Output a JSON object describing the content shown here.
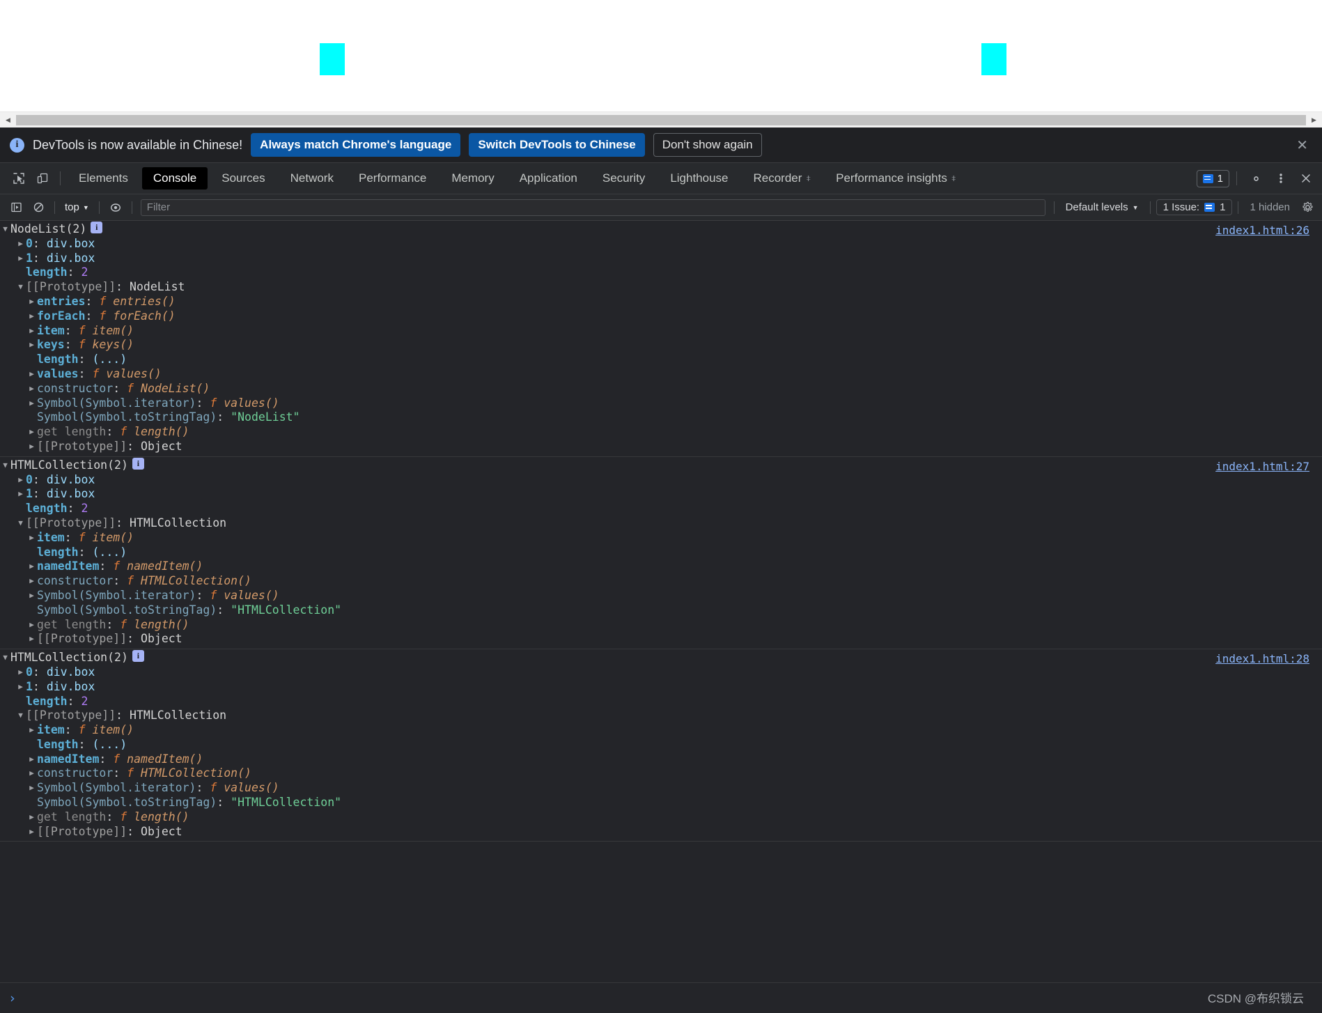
{
  "page": {
    "boxes": [
      {
        "name": "box-0"
      },
      {
        "name": "box-1"
      }
    ],
    "box_color": "#00ffff",
    "background": "#ffffff"
  },
  "banner": {
    "icon": "info-icon",
    "text": "DevTools is now available in Chinese!",
    "primary_button": "Always match Chrome's language",
    "secondary_button": "Switch DevTools to Chinese",
    "dismiss_button": "Don't show again",
    "close_label": "✕"
  },
  "tabbar": {
    "inspect_icon": "inspect-element-icon",
    "device_icon": "device-toolbar-icon",
    "tabs": [
      {
        "label": "Elements",
        "active": false,
        "flask": false
      },
      {
        "label": "Console",
        "active": true,
        "flask": false
      },
      {
        "label": "Sources",
        "active": false,
        "flask": false
      },
      {
        "label": "Network",
        "active": false,
        "flask": false
      },
      {
        "label": "Performance",
        "active": false,
        "flask": false
      },
      {
        "label": "Memory",
        "active": false,
        "flask": false
      },
      {
        "label": "Application",
        "active": false,
        "flask": false
      },
      {
        "label": "Security",
        "active": false,
        "flask": false
      },
      {
        "label": "Lighthouse",
        "active": false,
        "flask": false
      },
      {
        "label": "Recorder",
        "active": false,
        "flask": true
      },
      {
        "label": "Performance insights",
        "active": false,
        "flask": true
      }
    ],
    "issues_count": "1",
    "settings_icon": "gear-icon",
    "more_icon": "more-vertical-icon",
    "close_icon": "close-icon",
    "flask_glyph": "⧧"
  },
  "console_toolbar": {
    "execute_icon": "execute-snippet-icon",
    "clear_icon": "clear-console-icon",
    "context": "top",
    "eye_icon": "live-expression-icon",
    "filter_placeholder": "Filter",
    "filter_value": "",
    "levels": "Default levels",
    "issue_label": "1 Issue:",
    "issue_badge_count": "1",
    "hidden_label": "1 hidden",
    "settings_icon": "console-settings-gear-icon"
  },
  "console_logs": [
    {
      "source": "index1.html:26",
      "header": {
        "type": "NodeList",
        "count": "2",
        "text": "NodeList(2)"
      },
      "rows": [
        {
          "indent": 1,
          "tri": "closed",
          "parts": [
            {
              "t": "0",
              "c": "c-key"
            },
            {
              "t": ": ",
              "c": "c-punc"
            },
            {
              "t": "div.box",
              "c": "c-val"
            }
          ]
        },
        {
          "indent": 1,
          "tri": "closed",
          "parts": [
            {
              "t": "1",
              "c": "c-key"
            },
            {
              "t": ": ",
              "c": "c-punc"
            },
            {
              "t": "div.box",
              "c": "c-val"
            }
          ]
        },
        {
          "indent": 1,
          "tri": "none",
          "parts": [
            {
              "t": "length",
              "c": "c-key"
            },
            {
              "t": ": ",
              "c": "c-punc"
            },
            {
              "t": "2",
              "c": "c-num"
            }
          ]
        },
        {
          "indent": 1,
          "tri": "open",
          "parts": [
            {
              "t": "[[Prototype]]",
              "c": "c-proto"
            },
            {
              "t": ": ",
              "c": "c-punc"
            },
            {
              "t": "NodeList",
              "c": "c-plain"
            }
          ]
        },
        {
          "indent": 2,
          "tri": "closed",
          "parts": [
            {
              "t": "entries",
              "c": "c-key"
            },
            {
              "t": ": ",
              "c": "c-punc"
            },
            {
              "t": "f ",
              "c": "c-fnkw"
            },
            {
              "t": "entries()",
              "c": "c-fn"
            }
          ]
        },
        {
          "indent": 2,
          "tri": "closed",
          "parts": [
            {
              "t": "forEach",
              "c": "c-key"
            },
            {
              "t": ": ",
              "c": "c-punc"
            },
            {
              "t": "f ",
              "c": "c-fnkw"
            },
            {
              "t": "forEach()",
              "c": "c-fn"
            }
          ]
        },
        {
          "indent": 2,
          "tri": "closed",
          "parts": [
            {
              "t": "item",
              "c": "c-key"
            },
            {
              "t": ": ",
              "c": "c-punc"
            },
            {
              "t": "f ",
              "c": "c-fnkw"
            },
            {
              "t": "item()",
              "c": "c-fn"
            }
          ]
        },
        {
          "indent": 2,
          "tri": "closed",
          "parts": [
            {
              "t": "keys",
              "c": "c-key"
            },
            {
              "t": ": ",
              "c": "c-punc"
            },
            {
              "t": "f ",
              "c": "c-fnkw"
            },
            {
              "t": "keys()",
              "c": "c-fn"
            }
          ]
        },
        {
          "indent": 2,
          "tri": "none",
          "parts": [
            {
              "t": "length",
              "c": "c-key"
            },
            {
              "t": ": ",
              "c": "c-punc"
            },
            {
              "t": "(...)",
              "c": "c-dots"
            }
          ]
        },
        {
          "indent": 2,
          "tri": "closed",
          "parts": [
            {
              "t": "values",
              "c": "c-key"
            },
            {
              "t": ": ",
              "c": "c-punc"
            },
            {
              "t": "f ",
              "c": "c-fnkw"
            },
            {
              "t": "values()",
              "c": "c-fn"
            }
          ]
        },
        {
          "indent": 2,
          "tri": "closed",
          "parts": [
            {
              "t": "constructor",
              "c": "c-keyd"
            },
            {
              "t": ": ",
              "c": "c-punc"
            },
            {
              "t": "f ",
              "c": "c-fnkw"
            },
            {
              "t": "NodeList()",
              "c": "c-fn"
            }
          ]
        },
        {
          "indent": 2,
          "tri": "closed",
          "parts": [
            {
              "t": "Symbol(Symbol.iterator)",
              "c": "c-keyd"
            },
            {
              "t": ": ",
              "c": "c-punc"
            },
            {
              "t": "f ",
              "c": "c-fnkw"
            },
            {
              "t": "values()",
              "c": "c-fn"
            }
          ]
        },
        {
          "indent": 2,
          "tri": "none",
          "parts": [
            {
              "t": "Symbol(Symbol.toStringTag)",
              "c": "c-keyd"
            },
            {
              "t": ": ",
              "c": "c-punc"
            },
            {
              "t": "\"NodeList\"",
              "c": "c-str"
            }
          ]
        },
        {
          "indent": 2,
          "tri": "closed",
          "parts": [
            {
              "t": "get length",
              "c": "c-keyg"
            },
            {
              "t": ": ",
              "c": "c-punc"
            },
            {
              "t": "f ",
              "c": "c-fnkw"
            },
            {
              "t": "length()",
              "c": "c-fn"
            }
          ]
        },
        {
          "indent": 2,
          "tri": "closed",
          "parts": [
            {
              "t": "[[Prototype]]",
              "c": "c-proto"
            },
            {
              "t": ": ",
              "c": "c-punc"
            },
            {
              "t": "Object",
              "c": "c-plain"
            }
          ]
        }
      ]
    },
    {
      "source": "index1.html:27",
      "header": {
        "type": "HTMLCollection",
        "count": "2",
        "text": "HTMLCollection(2)"
      },
      "rows": [
        {
          "indent": 1,
          "tri": "closed",
          "parts": [
            {
              "t": "0",
              "c": "c-key"
            },
            {
              "t": ": ",
              "c": "c-punc"
            },
            {
              "t": "div.box",
              "c": "c-val"
            }
          ]
        },
        {
          "indent": 1,
          "tri": "closed",
          "parts": [
            {
              "t": "1",
              "c": "c-key"
            },
            {
              "t": ": ",
              "c": "c-punc"
            },
            {
              "t": "div.box",
              "c": "c-val"
            }
          ]
        },
        {
          "indent": 1,
          "tri": "none",
          "parts": [
            {
              "t": "length",
              "c": "c-key"
            },
            {
              "t": ": ",
              "c": "c-punc"
            },
            {
              "t": "2",
              "c": "c-num"
            }
          ]
        },
        {
          "indent": 1,
          "tri": "open",
          "parts": [
            {
              "t": "[[Prototype]]",
              "c": "c-proto"
            },
            {
              "t": ": ",
              "c": "c-punc"
            },
            {
              "t": "HTMLCollection",
              "c": "c-plain"
            }
          ]
        },
        {
          "indent": 2,
          "tri": "closed",
          "parts": [
            {
              "t": "item",
              "c": "c-key"
            },
            {
              "t": ": ",
              "c": "c-punc"
            },
            {
              "t": "f ",
              "c": "c-fnkw"
            },
            {
              "t": "item()",
              "c": "c-fn"
            }
          ]
        },
        {
          "indent": 2,
          "tri": "none",
          "parts": [
            {
              "t": "length",
              "c": "c-key"
            },
            {
              "t": ": ",
              "c": "c-punc"
            },
            {
              "t": "(...)",
              "c": "c-dots"
            }
          ]
        },
        {
          "indent": 2,
          "tri": "closed",
          "parts": [
            {
              "t": "namedItem",
              "c": "c-key"
            },
            {
              "t": ": ",
              "c": "c-punc"
            },
            {
              "t": "f ",
              "c": "c-fnkw"
            },
            {
              "t": "namedItem()",
              "c": "c-fn"
            }
          ]
        },
        {
          "indent": 2,
          "tri": "closed",
          "parts": [
            {
              "t": "constructor",
              "c": "c-keyd"
            },
            {
              "t": ": ",
              "c": "c-punc"
            },
            {
              "t": "f ",
              "c": "c-fnkw"
            },
            {
              "t": "HTMLCollection()",
              "c": "c-fn"
            }
          ]
        },
        {
          "indent": 2,
          "tri": "closed",
          "parts": [
            {
              "t": "Symbol(Symbol.iterator)",
              "c": "c-keyd"
            },
            {
              "t": ": ",
              "c": "c-punc"
            },
            {
              "t": "f ",
              "c": "c-fnkw"
            },
            {
              "t": "values()",
              "c": "c-fn"
            }
          ]
        },
        {
          "indent": 2,
          "tri": "none",
          "parts": [
            {
              "t": "Symbol(Symbol.toStringTag)",
              "c": "c-keyd"
            },
            {
              "t": ": ",
              "c": "c-punc"
            },
            {
              "t": "\"HTMLCollection\"",
              "c": "c-str"
            }
          ]
        },
        {
          "indent": 2,
          "tri": "closed",
          "parts": [
            {
              "t": "get length",
              "c": "c-keyg"
            },
            {
              "t": ": ",
              "c": "c-punc"
            },
            {
              "t": "f ",
              "c": "c-fnkw"
            },
            {
              "t": "length()",
              "c": "c-fn"
            }
          ]
        },
        {
          "indent": 2,
          "tri": "closed",
          "parts": [
            {
              "t": "[[Prototype]]",
              "c": "c-proto"
            },
            {
              "t": ": ",
              "c": "c-punc"
            },
            {
              "t": "Object",
              "c": "c-plain"
            }
          ]
        }
      ]
    },
    {
      "source": "index1.html:28",
      "header": {
        "type": "HTMLCollection",
        "count": "2",
        "text": "HTMLCollection(2)"
      },
      "rows": [
        {
          "indent": 1,
          "tri": "closed",
          "parts": [
            {
              "t": "0",
              "c": "c-key"
            },
            {
              "t": ": ",
              "c": "c-punc"
            },
            {
              "t": "div.box",
              "c": "c-val"
            }
          ]
        },
        {
          "indent": 1,
          "tri": "closed",
          "parts": [
            {
              "t": "1",
              "c": "c-key"
            },
            {
              "t": ": ",
              "c": "c-punc"
            },
            {
              "t": "div.box",
              "c": "c-val"
            }
          ]
        },
        {
          "indent": 1,
          "tri": "none",
          "parts": [
            {
              "t": "length",
              "c": "c-key"
            },
            {
              "t": ": ",
              "c": "c-punc"
            },
            {
              "t": "2",
              "c": "c-num"
            }
          ]
        },
        {
          "indent": 1,
          "tri": "open",
          "parts": [
            {
              "t": "[[Prototype]]",
              "c": "c-proto"
            },
            {
              "t": ": ",
              "c": "c-punc"
            },
            {
              "t": "HTMLCollection",
              "c": "c-plain"
            }
          ]
        },
        {
          "indent": 2,
          "tri": "closed",
          "parts": [
            {
              "t": "item",
              "c": "c-key"
            },
            {
              "t": ": ",
              "c": "c-punc"
            },
            {
              "t": "f ",
              "c": "c-fnkw"
            },
            {
              "t": "item()",
              "c": "c-fn"
            }
          ]
        },
        {
          "indent": 2,
          "tri": "none",
          "parts": [
            {
              "t": "length",
              "c": "c-key"
            },
            {
              "t": ": ",
              "c": "c-punc"
            },
            {
              "t": "(...)",
              "c": "c-dots"
            }
          ]
        },
        {
          "indent": 2,
          "tri": "closed",
          "parts": [
            {
              "t": "namedItem",
              "c": "c-key"
            },
            {
              "t": ": ",
              "c": "c-punc"
            },
            {
              "t": "f ",
              "c": "c-fnkw"
            },
            {
              "t": "namedItem()",
              "c": "c-fn"
            }
          ]
        },
        {
          "indent": 2,
          "tri": "closed",
          "parts": [
            {
              "t": "constructor",
              "c": "c-keyd"
            },
            {
              "t": ": ",
              "c": "c-punc"
            },
            {
              "t": "f ",
              "c": "c-fnkw"
            },
            {
              "t": "HTMLCollection()",
              "c": "c-fn"
            }
          ]
        },
        {
          "indent": 2,
          "tri": "closed",
          "parts": [
            {
              "t": "Symbol(Symbol.iterator)",
              "c": "c-keyd"
            },
            {
              "t": ": ",
              "c": "c-punc"
            },
            {
              "t": "f ",
              "c": "c-fnkw"
            },
            {
              "t": "values()",
              "c": "c-fn"
            }
          ]
        },
        {
          "indent": 2,
          "tri": "none",
          "parts": [
            {
              "t": "Symbol(Symbol.toStringTag)",
              "c": "c-keyd"
            },
            {
              "t": ": ",
              "c": "c-punc"
            },
            {
              "t": "\"HTMLCollection\"",
              "c": "c-str"
            }
          ]
        },
        {
          "indent": 2,
          "tri": "closed",
          "parts": [
            {
              "t": "get length",
              "c": "c-keyg"
            },
            {
              "t": ": ",
              "c": "c-punc"
            },
            {
              "t": "f ",
              "c": "c-fnkw"
            },
            {
              "t": "length()",
              "c": "c-fn"
            }
          ]
        },
        {
          "indent": 2,
          "tri": "closed",
          "parts": [
            {
              "t": "[[Prototype]]",
              "c": "c-proto"
            },
            {
              "t": ": ",
              "c": "c-punc"
            },
            {
              "t": "Object",
              "c": "c-plain"
            }
          ]
        }
      ]
    }
  ],
  "prompt": {
    "caret": "›",
    "value": ""
  },
  "watermark": "CSDN @布织锁云",
  "colors": {
    "accent_blue": "#1a73e8",
    "banner_button": "#0b57a4",
    "box_cyan": "#00ffff",
    "devtools_bg": "#242529",
    "toolbar_bg": "#282a2d",
    "link_blue": "#8ab4f8"
  }
}
